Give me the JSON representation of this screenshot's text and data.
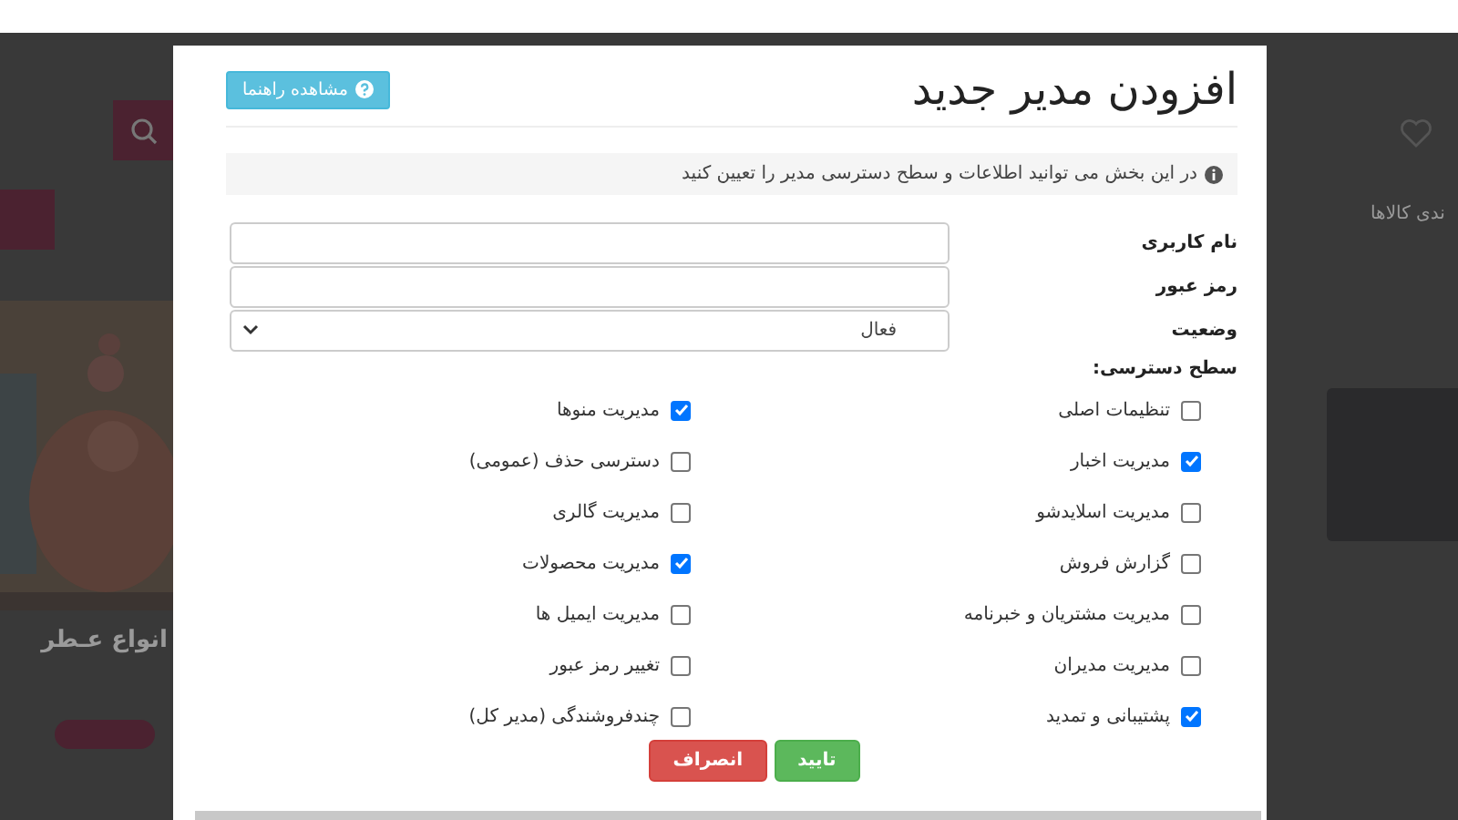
{
  "background": {
    "hero_title": "انواع عـطر",
    "section_title": "ندی کالاها"
  },
  "modal": {
    "title": "افزودن مدیر جدید",
    "help_button": "مشاهده راهنما",
    "info": "در این بخش می توانید اطلاعات و سطح دسترسی مدیر را تعیین کنید",
    "fields": [
      {
        "kind": "text",
        "label": "نام کاربری"
      },
      {
        "kind": "password",
        "label": "رمز عبور"
      },
      {
        "kind": "select",
        "label": "وضعیت",
        "value": "فعال"
      }
    ],
    "access_label": "سطح دسترسی:",
    "permissions": [
      {
        "label": "تنظیمات اصلی",
        "checked": false
      },
      {
        "label": "مدیریت منوها",
        "checked": true
      },
      {
        "label": "مدیریت اخبار",
        "checked": true
      },
      {
        "label": "دسترسی حذف (عمومی)",
        "checked": false
      },
      {
        "label": "مدیریت اسلایدشو",
        "checked": false
      },
      {
        "label": "مدیریت گالری",
        "checked": false
      },
      {
        "label": "گزارش فروش",
        "checked": false
      },
      {
        "label": "مدیریت محصولات",
        "checked": true
      },
      {
        "label": "مدیریت مشتریان و خبرنامه",
        "checked": false
      },
      {
        "label": "مدیریت ایمیل ها",
        "checked": false
      },
      {
        "label": "مدیریت مدیران",
        "checked": false
      },
      {
        "label": "تغییر رمز عبور",
        "checked": false
      },
      {
        "label": "پشتیبانی و تمدید",
        "checked": true
      },
      {
        "label": "چندفروشندگی (مدیر کل)",
        "checked": false
      }
    ],
    "buttons": [
      {
        "kind": "confirm",
        "label": "تایید"
      },
      {
        "kind": "cancel",
        "label": "انصراف"
      }
    ]
  }
}
